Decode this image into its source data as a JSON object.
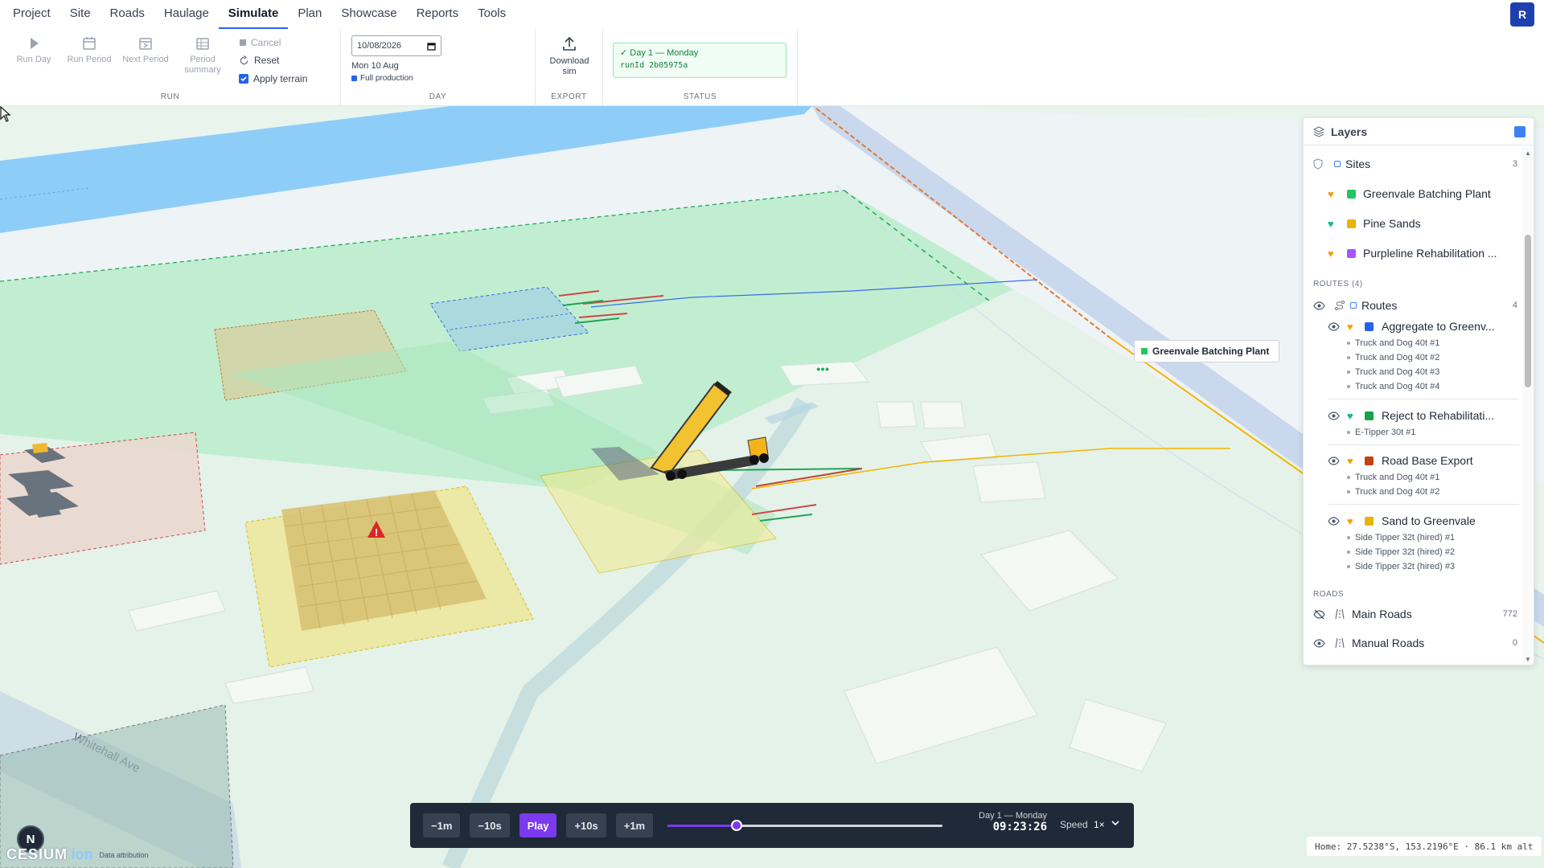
{
  "nav": {
    "items": [
      "Project",
      "Site",
      "Roads",
      "Haulage",
      "Simulate",
      "Plan",
      "Showcase",
      "Reports",
      "Tools"
    ],
    "active": "Simulate",
    "avatar_initial": "R"
  },
  "ribbon": {
    "run": {
      "label": "RUN",
      "run_day": "Run Day",
      "run_period": "Run Period",
      "next_period": "Next Period",
      "period_summary": "Period summary",
      "cancel": "Cancel",
      "reset": "Reset",
      "apply_terrain": "Apply terrain",
      "apply_terrain_checked": true
    },
    "day": {
      "label": "DAY",
      "date_value": "10/08/2026",
      "day_text": "Mon 10 Aug",
      "production": "Full production"
    },
    "export": {
      "label": "EXPORT",
      "download": "Download sim"
    },
    "status": {
      "label": "STATUS",
      "line1": "✓ Day 1 — Monday",
      "line2": "runId 2b05975a"
    }
  },
  "map": {
    "street_label": "Whitehall Ave",
    "site_label": "Greenvale Batching Plant"
  },
  "layers": {
    "title": "Layers",
    "sites": {
      "label": "Sites",
      "count": "3",
      "items": [
        {
          "name": "Greenvale Batching Plant",
          "color": "#22c55e",
          "heart": "#f59e0b"
        },
        {
          "name": "Pine Sands",
          "color": "#eab308",
          "heart": "#10b981"
        },
        {
          "name": "Purpleline Rehabilitation ...",
          "color": "#a855f7",
          "heart": "#f59e0b"
        }
      ]
    },
    "routes_section": "ROUTES (4)",
    "routes": {
      "label": "Routes",
      "count": "4",
      "items": [
        {
          "name": "Aggregate to Greenv...",
          "color": "#2563eb",
          "heart": "#f59e0b",
          "vehicles": [
            "Truck and Dog 40t #1",
            "Truck and Dog 40t #2",
            "Truck and Dog 40t #3",
            "Truck and Dog 40t #4"
          ]
        },
        {
          "name": "Reject to Rehabilitati...",
          "color": "#16a34a",
          "heart": "#10b981",
          "vehicles": [
            "E-Tipper 30t #1"
          ]
        },
        {
          "name": "Road Base Export",
          "color": "#c2410c",
          "heart": "#f59e0b",
          "vehicles": [
            "Truck and Dog 40t #1",
            "Truck and Dog 40t #2"
          ]
        },
        {
          "name": "Sand to Greenvale",
          "color": "#eab308",
          "heart": "#f59e0b",
          "vehicles": [
            "Side Tipper 32t (hired) #1",
            "Side Tipper 32t (hired) #2",
            "Side Tipper 32t (hired) #3"
          ]
        }
      ]
    },
    "roads_section": "ROADS",
    "roads": [
      {
        "name": "Main Roads",
        "count": "772"
      },
      {
        "name": "Manual Roads",
        "count": "0"
      }
    ]
  },
  "playback": {
    "back_1m": "−1m",
    "back_10s": "−10s",
    "play": "Play",
    "fwd_10s": "+10s",
    "fwd_1m": "+1m",
    "progress": 0.25,
    "day": "Day 1 — Monday",
    "clock": "09:23:26",
    "speed_label": "Speed",
    "speed_value": "1×"
  },
  "coords": "Home: 27.5238°S, 153.2196°E · 86.1 km alt",
  "compass": "N",
  "attribution": {
    "logo": "CESIUM",
    "ion": "ion",
    "data": "Data attribution"
  }
}
